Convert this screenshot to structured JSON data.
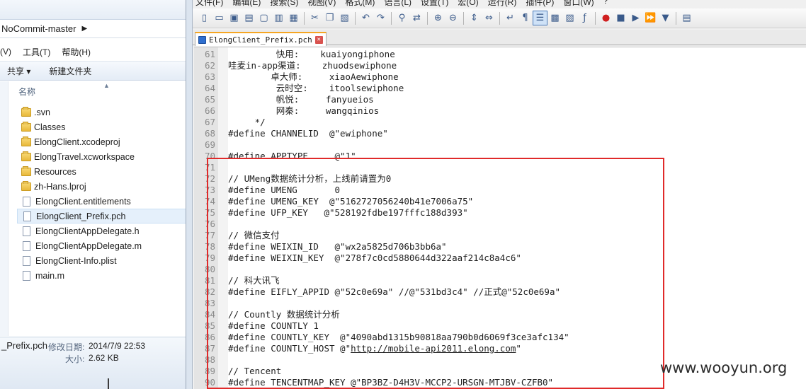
{
  "explorer": {
    "breadcrumb": "NoCommit-master",
    "menu": [
      "(V)",
      "工具(T)",
      "帮助(H)"
    ],
    "commands": {
      "share": "共享 ▾",
      "new_folder": "新建文件夹"
    },
    "column_name": "名称",
    "files": [
      {
        "name": ".svn",
        "type": "folder"
      },
      {
        "name": "Classes",
        "type": "folder"
      },
      {
        "name": "ElongClient.xcodeproj",
        "type": "folder"
      },
      {
        "name": "ElongTravel.xcworkspace",
        "type": "folder"
      },
      {
        "name": "Resources",
        "type": "folder"
      },
      {
        "name": "zh-Hans.lproj",
        "type": "folder"
      },
      {
        "name": "ElongClient.entitlements",
        "type": "file"
      },
      {
        "name": "ElongClient_Prefix.pch",
        "type": "file",
        "selected": true
      },
      {
        "name": "ElongClientAppDelegate.h",
        "type": "file"
      },
      {
        "name": "ElongClientAppDelegate.m",
        "type": "file"
      },
      {
        "name": "ElongClient-Info.plist",
        "type": "file"
      },
      {
        "name": "main.m",
        "type": "file"
      }
    ],
    "details": {
      "file_name": "_Prefix.pch",
      "modified_label": "修改日期:",
      "modified_value": "2014/7/9 22:53",
      "size_label": "大小:",
      "size_value": "2.62 KB"
    }
  },
  "npp": {
    "menu": [
      "文件(F)",
      "编辑(E)",
      "搜索(S)",
      "视图(V)",
      "格式(M)",
      "语言(L)",
      "设置(T)",
      "宏(O)",
      "运行(R)",
      "插件(P)",
      "窗口(W)",
      "?"
    ],
    "toolbar_icons": [
      "new-icon",
      "open-icon",
      "save-icon",
      "save-all-icon",
      "close-icon",
      "close-all-icon",
      "print-icon",
      "sep",
      "cut-icon",
      "copy-icon",
      "paste-icon",
      "sep",
      "undo-icon",
      "redo-icon",
      "sep",
      "find-icon",
      "replace-icon",
      "sep",
      "zoom-in-icon",
      "zoom-out-icon",
      "sep",
      "sync-v-icon",
      "sync-h-icon",
      "sep",
      "wrap-icon",
      "all-chars-icon",
      "indent-guide-icon",
      "user-lang-icon",
      "doc-map-icon",
      "func-list-icon",
      "sep",
      "record-icon",
      "stop-icon",
      "play-icon",
      "play-multi-icon",
      "save-macro-icon",
      "sep",
      "launch-icon"
    ],
    "tab_title": "ElongClient_Prefix.pch",
    "lines": [
      {
        "n": "61",
        "text": "         快用:    kuaiyongiphone"
      },
      {
        "n": "62",
        "text": "哇麦in-app渠道:    zhuodsewiphone"
      },
      {
        "n": "63",
        "text": "        卓大师:     xiaoAewiphone"
      },
      {
        "n": "64",
        "text": "         云时空:    itoolsewiphone"
      },
      {
        "n": "65",
        "text": "         帆悦:     fanyueios"
      },
      {
        "n": "66",
        "text": "         网秦:     wangqinios"
      },
      {
        "n": "67",
        "text": "     */"
      },
      {
        "n": "68",
        "text": "#define CHANNELID  @\"ewiphone\""
      },
      {
        "n": "69",
        "text": ""
      },
      {
        "n": "70",
        "text": "#define APPTYPE     @\"1\""
      },
      {
        "n": "71",
        "text": ""
      },
      {
        "n": "72",
        "text": "// UMeng数据统计分析，上线前请置为0"
      },
      {
        "n": "73",
        "text": "#define UMENG       0"
      },
      {
        "n": "74",
        "text": "#define UMENG_KEY  @\"5162727056240b41e7006a75\""
      },
      {
        "n": "75",
        "text": "#define UFP_KEY   @\"528192fdbe197fffc188d393\""
      },
      {
        "n": "76",
        "text": ""
      },
      {
        "n": "77",
        "text": "// 微信支付"
      },
      {
        "n": "78",
        "text": "#define WEIXIN_ID   @\"wx2a5825d706b3bb6a\""
      },
      {
        "n": "79",
        "text": "#define WEIXIN_KEY  @\"278f7c0cd5880644d322aaf214c8a4c6\""
      },
      {
        "n": "80",
        "text": ""
      },
      {
        "n": "81",
        "text": "// 科大讯飞"
      },
      {
        "n": "82",
        "text": "#define EIFLY_APPID @\"52c0e69a\" //@\"531bd3c4\" //正式@\"52c0e69a\""
      },
      {
        "n": "83",
        "text": ""
      },
      {
        "n": "84",
        "text": "// Countly 数据统计分析"
      },
      {
        "n": "85",
        "text": "#define COUNTLY 1"
      },
      {
        "n": "86",
        "text": "#define COUNTLY_KEY  @\"4090abd1315b90818aa790b0d6069f3ce3afc134\""
      },
      {
        "n": "87",
        "text": "#define COUNTLY_HOST @\"http://mobile-api2011.elong.com\""
      },
      {
        "n": "88",
        "text": ""
      },
      {
        "n": "89",
        "text": "// Tencent"
      },
      {
        "n": "90",
        "text": "#define TENCENTMAP_KEY @\"BP3BZ-D4H3V-MCCP2-URSGN-MTJBV-CZFB0\""
      }
    ]
  },
  "watermark": "www.wooyun.org",
  "colors": {
    "highlight": "#e02a2a",
    "tab_accent": "#f5a623"
  }
}
